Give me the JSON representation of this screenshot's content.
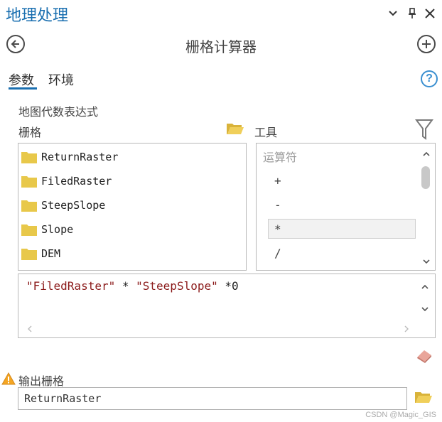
{
  "pane": {
    "title": "地理处理"
  },
  "tool": {
    "title": "栅格计算器"
  },
  "tabs": [
    {
      "label": "参数"
    },
    {
      "label": "环境"
    }
  ],
  "section": {
    "label": "地图代数表达式"
  },
  "rasters": {
    "label": "栅格",
    "items": [
      "ReturnRaster",
      "FiledRaster",
      "SteepSlope",
      "Slope",
      "DEM"
    ]
  },
  "tools": {
    "label": "工具",
    "header": "运算符",
    "items": [
      "+",
      "-",
      "*",
      "/"
    ],
    "selected_index": 2
  },
  "expression": {
    "raster1": "\"FiledRaster\"",
    "op1": " * ",
    "raster2": "\"SteepSlope\"",
    "rest": " *0"
  },
  "output": {
    "label": "输出栅格",
    "value": "ReturnRaster"
  },
  "watermark": "CSDN @Magic_GIS",
  "colors": {
    "accent": "#1a6fb0",
    "folder": "#e8c84a",
    "expr_string": "#8b1a1a"
  }
}
